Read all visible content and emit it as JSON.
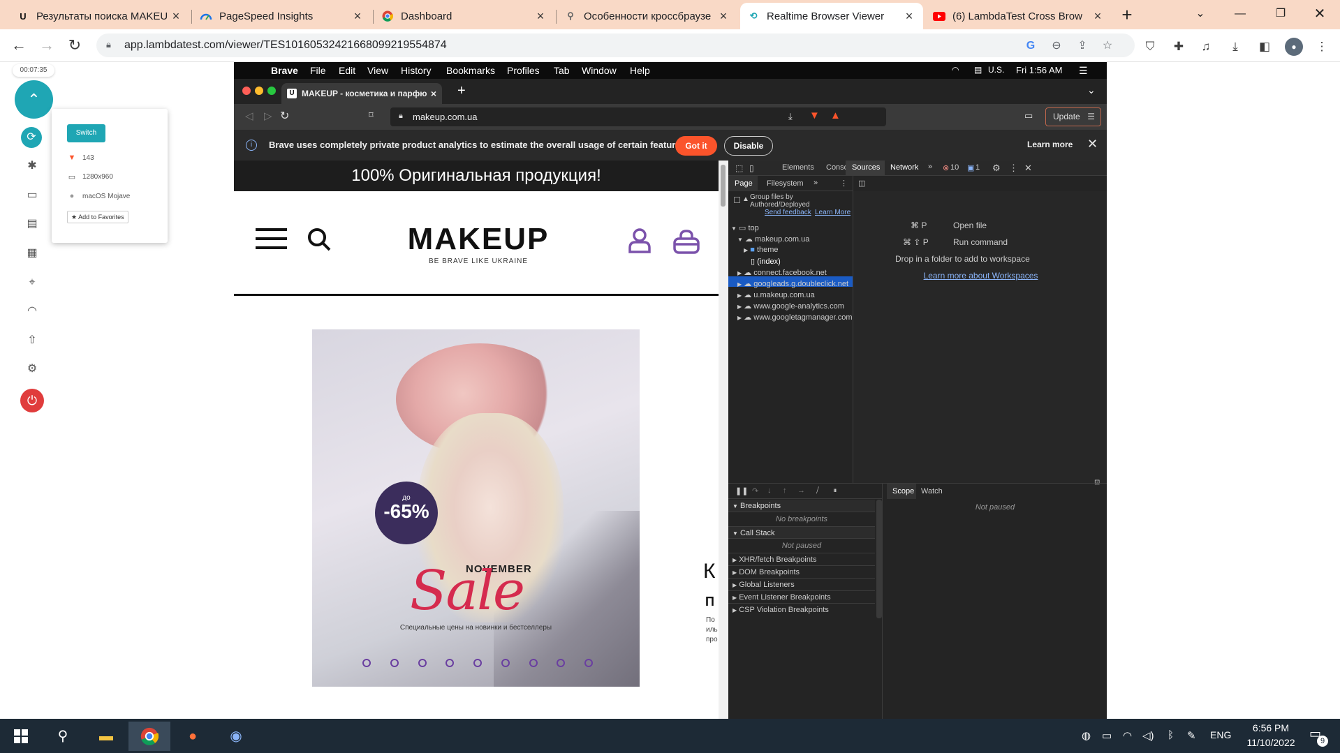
{
  "browser": {
    "tabs": [
      {
        "title": "Результаты поиска MAKEU",
        "icon": "makeup-favicon",
        "active": false
      },
      {
        "title": "PageSpeed Insights",
        "icon": "pagespeed-favicon",
        "active": false
      },
      {
        "title": "Dashboard",
        "icon": "chrome-favicon",
        "active": false
      },
      {
        "title": "Особенности кроссбраузе",
        "icon": "pin-favicon",
        "active": false
      },
      {
        "title": "Realtime Browser Viewer",
        "icon": "lambdatest-favicon",
        "active": true
      },
      {
        "title": "(6) LambdaTest Cross Brow",
        "icon": "youtube-favicon",
        "active": false
      }
    ],
    "url": "app.lambdatest.com/viewer/TES10160532421668099219554874"
  },
  "lambdatest": {
    "timer": "00:07:35",
    "switch_label": "Switch",
    "popup": {
      "browser_version": "143",
      "resolution": "1280x960",
      "os": "macOS Mojave",
      "favorites_label": "★ Add to Favorites"
    }
  },
  "mac": {
    "menu": [
      "Brave",
      "File",
      "Edit",
      "View",
      "History",
      "Bookmarks",
      "Profiles",
      "Tab",
      "Window",
      "Help"
    ],
    "locale": "U.S.",
    "clock": "Fri 1:56 AM"
  },
  "brave": {
    "tab_title": "MAKEUP - косметика и парфю",
    "url": "makeup.com.ua",
    "update_label": "Update",
    "info_text": "Brave uses completely private product analytics to estimate the overall usage of certain features",
    "got_it": "Got it",
    "disable": "Disable",
    "learn_more": "Learn more"
  },
  "webpage": {
    "promo": "100% Оригинальная продукция!",
    "logo": "MAKEUP",
    "tagline": "BE BRAVE LIKE UKRAINE",
    "banner": {
      "badge_small": "до",
      "badge_value": "-65%",
      "month": "NOVEMBER",
      "sale": "Sale",
      "subtitle": "Специальные цены на новинки и бестселлеры",
      "dots": 9
    },
    "right_clip": {
      "k": "К",
      "p": "П",
      "lines": [
        "По",
        "иль",
        "про"
      ]
    }
  },
  "devtools": {
    "tabs": [
      "Elements",
      "Console",
      "Sources",
      "Network"
    ],
    "errors": "10",
    "messages": "1",
    "nav_tabs": [
      "Page",
      "Filesystem"
    ],
    "group_label_1": "Group files by",
    "group_label_2": "Authored/Deployed",
    "send_feedback": "Send feedback",
    "learn_more": "Learn More",
    "tree": [
      {
        "label": "top",
        "depth": 0,
        "kind": "frame"
      },
      {
        "label": "makeup.com.ua",
        "depth": 1,
        "kind": "cloud"
      },
      {
        "label": "theme",
        "depth": 2,
        "kind": "folder"
      },
      {
        "label": "(index)",
        "depth": 2,
        "kind": "file",
        "selected": true
      },
      {
        "label": "connect.facebook.net",
        "depth": 1,
        "kind": "cloud"
      },
      {
        "label": "googleads.g.doubleclick.net",
        "depth": 1,
        "kind": "cloud"
      },
      {
        "label": "u.makeup.com.ua",
        "depth": 1,
        "kind": "cloud"
      },
      {
        "label": "www.google-analytics.com",
        "depth": 1,
        "kind": "cloud"
      },
      {
        "label": "www.googletagmanager.com",
        "depth": 1,
        "kind": "cloud"
      }
    ],
    "shortcuts": [
      {
        "keys": "⌘ P",
        "label": "Open file"
      },
      {
        "keys": "⌘ ⇧ P",
        "label": "Run command"
      }
    ],
    "drop_text": "Drop in a folder to add to workspace",
    "workspaces_link": "Learn more about Workspaces",
    "debugger": {
      "breakpoints": "Breakpoints",
      "no_breakpoints": "No breakpoints",
      "call_stack": "Call Stack",
      "not_paused": "Not paused",
      "sections": [
        "XHR/fetch Breakpoints",
        "DOM Breakpoints",
        "Global Listeners",
        "Event Listener Breakpoints",
        "CSP Violation Breakpoints"
      ],
      "scope": "Scope",
      "watch": "Watch",
      "scope_status": "Not paused"
    }
  },
  "taskbar": {
    "language": "ENG",
    "time": "6:56 PM",
    "date": "11/10/2022",
    "notifications": "9"
  }
}
